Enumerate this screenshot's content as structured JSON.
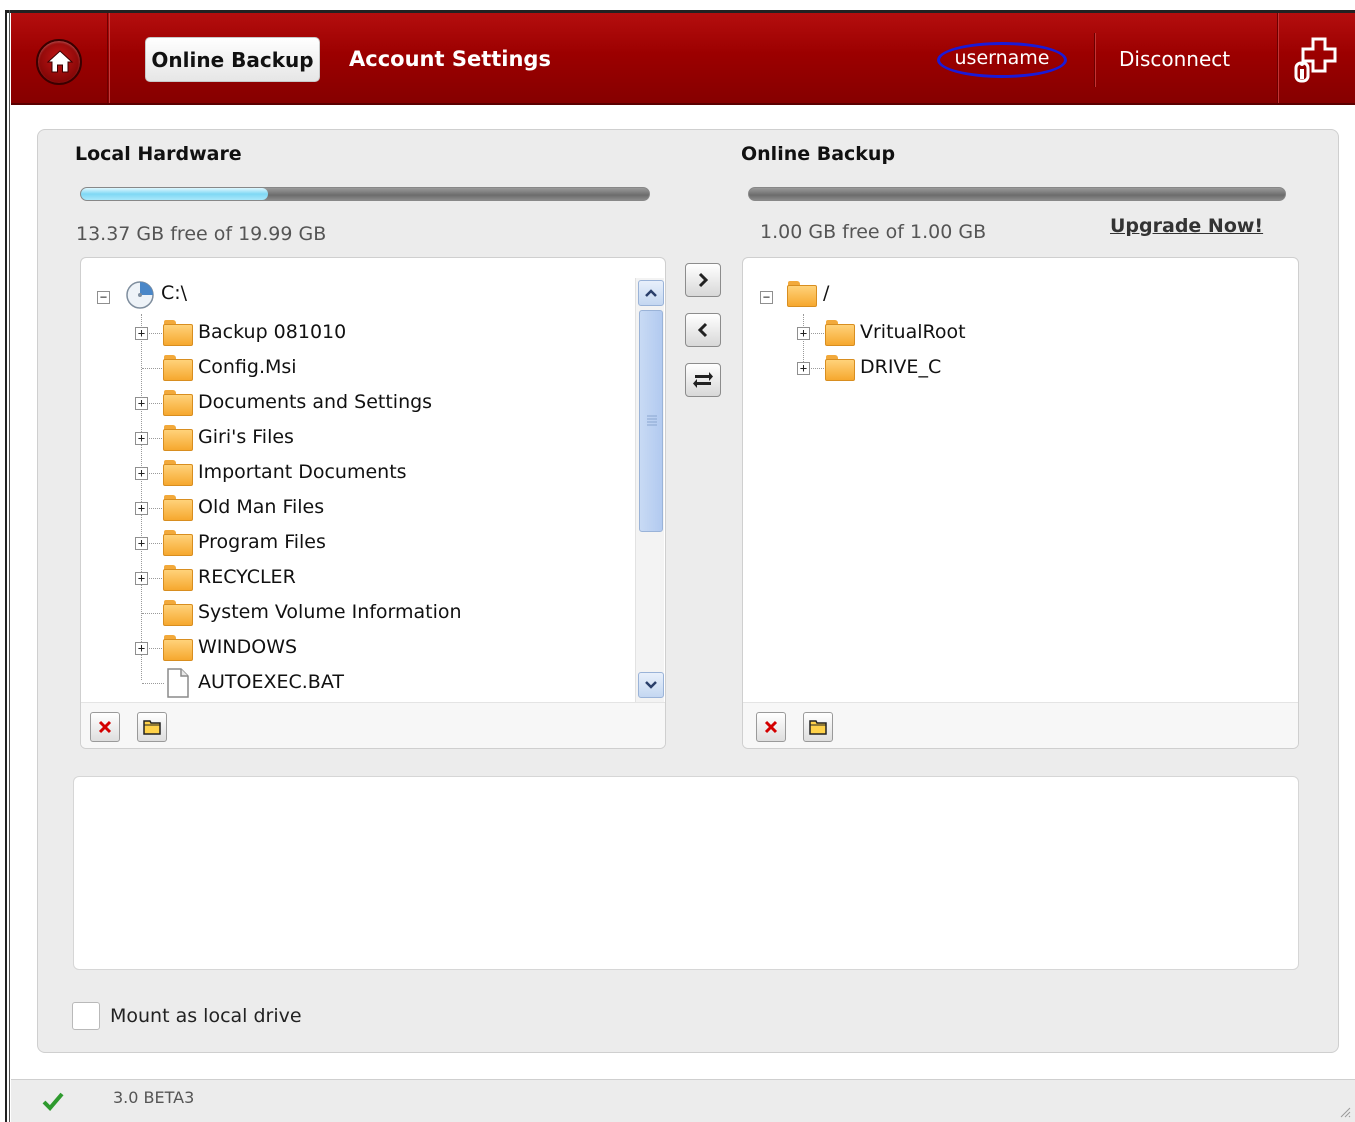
{
  "header": {
    "home_icon": "home-icon",
    "tabs": [
      {
        "label": "Online Backup",
        "active": true
      },
      {
        "label": "Account Settings",
        "active": false
      }
    ],
    "username": "username",
    "disconnect": "Disconnect",
    "plugin_icon": "plugin-icon",
    "colors": {
      "header_red": "#9c0000",
      "username_oval": "#1a1ad8"
    }
  },
  "local": {
    "title": "Local Hardware",
    "usage_fraction": 0.33,
    "space_text": "13.37  GB free of  19.99  GB",
    "tree": {
      "root": "C:\\",
      "items": [
        {
          "label": "Backup 081010",
          "expandable": true,
          "type": "folder"
        },
        {
          "label": "Config.Msi",
          "expandable": false,
          "type": "folder"
        },
        {
          "label": "Documents and Settings",
          "expandable": true,
          "type": "folder"
        },
        {
          "label": "Giri's Files",
          "expandable": true,
          "type": "folder"
        },
        {
          "label": "Important Documents",
          "expandable": true,
          "type": "folder"
        },
        {
          "label": "Old Man Files",
          "expandable": true,
          "type": "folder"
        },
        {
          "label": "Program Files",
          "expandable": true,
          "type": "folder"
        },
        {
          "label": "RECYCLER",
          "expandable": true,
          "type": "folder"
        },
        {
          "label": "System Volume Information",
          "expandable": false,
          "type": "folder"
        },
        {
          "label": "WINDOWS",
          "expandable": true,
          "type": "folder"
        },
        {
          "label": "AUTOEXEC.BAT",
          "expandable": false,
          "type": "file"
        }
      ]
    }
  },
  "online": {
    "title": "Online Backup",
    "usage_fraction": 0,
    "space_text": "1.00  GB free of  1.00  GB",
    "upgrade": "Upgrade Now!",
    "tree": {
      "root": "/",
      "items": [
        {
          "label": "VritualRoot",
          "expandable": true,
          "type": "folder"
        },
        {
          "label": "DRIVE_C",
          "expandable": true,
          "type": "folder"
        }
      ]
    }
  },
  "transfer_buttons": [
    "chevron-right-icon",
    "chevron-left-icon",
    "sync-icon"
  ],
  "mount": {
    "label": "Mount as local drive",
    "checked": false
  },
  "status": {
    "version": "3.0 BETA3",
    "status_icon": "checkmark-icon"
  }
}
